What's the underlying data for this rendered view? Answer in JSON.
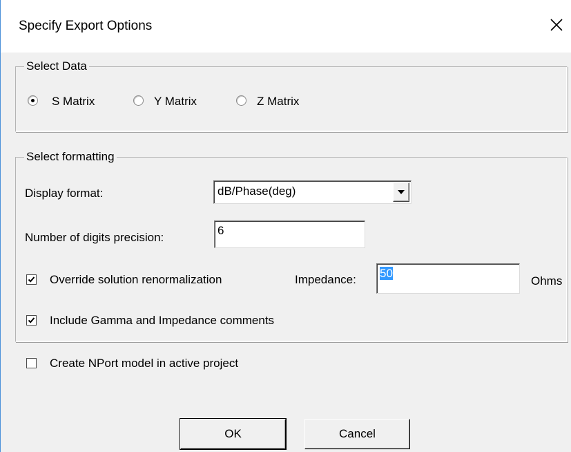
{
  "dialog": {
    "title": "Specify Export Options",
    "close_icon": "close-icon"
  },
  "select_data": {
    "legend": "Select Data",
    "options": [
      {
        "label": "S Matrix",
        "checked": true
      },
      {
        "label": "Y Matrix",
        "checked": false
      },
      {
        "label": "Z Matrix",
        "checked": false
      }
    ]
  },
  "formatting": {
    "legend": "Select formatting",
    "display_format_label": "Display format:",
    "display_format_value": "dB/Phase(deg)",
    "precision_label": "Number of digits precision:",
    "precision_value": "6",
    "override_label": "Override solution renormalization",
    "override_checked": true,
    "impedance_label": "Impedance:",
    "impedance_value": "50",
    "impedance_unit": "Ohms",
    "gamma_label": "Include Gamma and Impedance comments",
    "gamma_checked": true
  },
  "nport": {
    "label": "Create NPort model in active project",
    "checked": false
  },
  "buttons": {
    "ok": "OK",
    "cancel": "Cancel"
  }
}
